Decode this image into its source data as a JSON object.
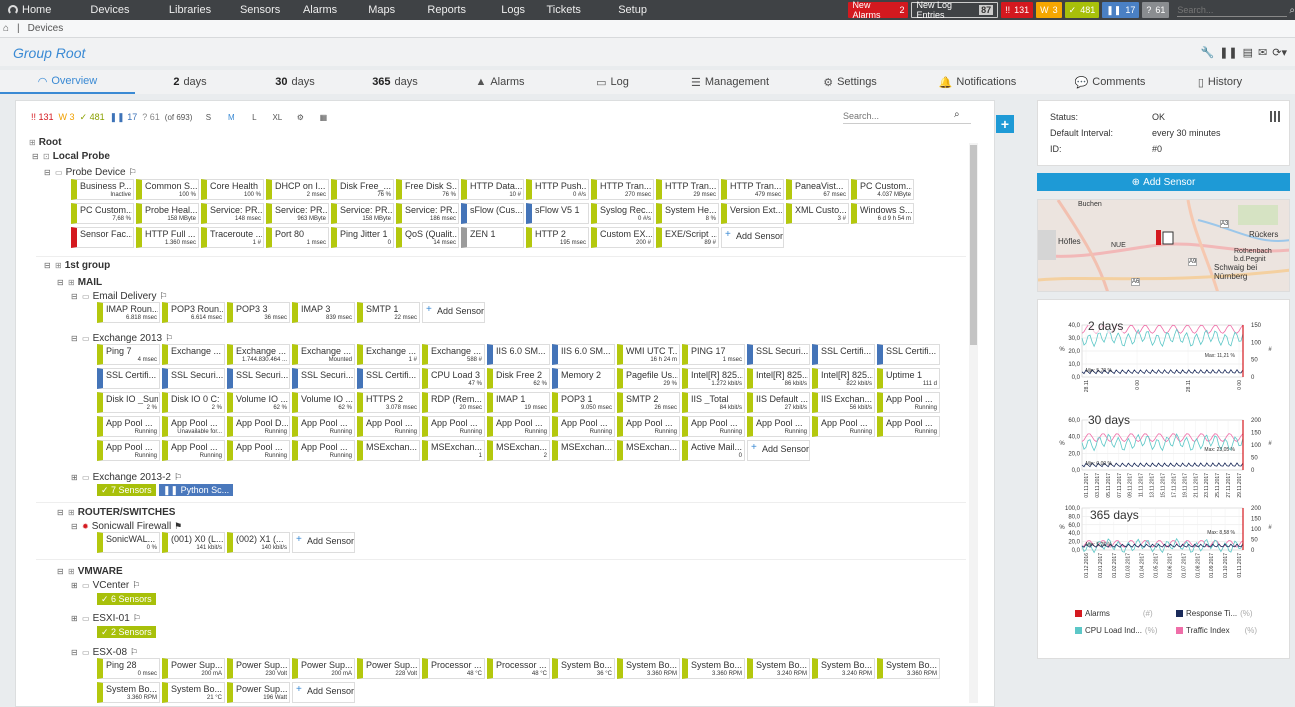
{
  "nav": {
    "home": "Home",
    "items": [
      "Devices",
      "Libraries",
      "Sensors",
      "Alarms",
      "Maps",
      "Reports",
      "Logs",
      "Tickets",
      "Setup"
    ],
    "new_alarms_label": "New Alarms",
    "new_alarms_count": "2",
    "new_log_label": "New Log Entries",
    "new_log_count": "87",
    "badge_red": "131",
    "badge_yellow": "3",
    "badge_green": "481",
    "badge_blue": "17",
    "badge_gray": "61",
    "search_placeholder": "Search..."
  },
  "breadcrumb": {
    "item": "Devices"
  },
  "page": {
    "title": "Group Root"
  },
  "tabs": [
    {
      "label": "Overview"
    },
    {
      "num": "2",
      "label": "days"
    },
    {
      "num": "30",
      "label": "days"
    },
    {
      "num": "365",
      "label": "days"
    },
    {
      "label": "Alarms"
    },
    {
      "label": "Log"
    },
    {
      "label": "Management"
    },
    {
      "label": "Settings"
    },
    {
      "label": "Notifications"
    },
    {
      "label": "Comments"
    },
    {
      "label": "History"
    }
  ],
  "filter": {
    "red": "131",
    "yellow": "3",
    "green": "481",
    "blue": "17",
    "gray": "61",
    "total": "(of 693)",
    "sizes": [
      "S",
      "M",
      "L",
      "XL"
    ],
    "search_placeholder": "Search..."
  },
  "tree": {
    "root": "Root",
    "local_probe": "Local Probe",
    "probe_device": "Probe Device",
    "group1": "1st group",
    "mail": "MAIL",
    "email_delivery": "Email Delivery",
    "exchange2013": "Exchange 2013",
    "exchange2013_2": "Exchange 2013-2",
    "seven_sensors": "7 Sensors",
    "python_chip": "Python Sc...",
    "router": "ROUTER/SWITCHES",
    "sonicwall": "Sonicwall Firewall",
    "vmware": "VMWARE",
    "vcenter": "VCenter",
    "six_sensors": "6 Sensors",
    "esxi01": "ESXI-01",
    "two_sensors": "2 Sensors",
    "esx08": "ESX-08",
    "add_sensor": "Add Sensor"
  },
  "probe_sensors": [
    {
      "n": "Business P...",
      "v": "Inactive",
      "c": "g"
    },
    {
      "n": "Common S...",
      "v": "100 %",
      "c": "g"
    },
    {
      "n": "Core Health",
      "v": "100 %",
      "c": "g"
    },
    {
      "n": "DHCP on I...",
      "v": "2 msec",
      "c": "g"
    },
    {
      "n": "Disk Free_...",
      "v": "76 %",
      "c": "g"
    },
    {
      "n": "Free Disk S...",
      "v": "76 %",
      "c": "g"
    },
    {
      "n": "HTTP Data...",
      "v": "10 #",
      "c": "g"
    },
    {
      "n": "HTTP Push...",
      "v": "0 #/s",
      "c": "g"
    },
    {
      "n": "HTTP Tran...",
      "v": "270 msec",
      "c": "g"
    },
    {
      "n": "HTTP Tran...",
      "v": "29 msec",
      "c": "g"
    },
    {
      "n": "HTTP Tran...",
      "v": "479 msec",
      "c": "g"
    },
    {
      "n": "PaneaVist...",
      "v": "67 msec",
      "c": "g"
    },
    {
      "n": "PC Custom...",
      "v": "4.037 MByte",
      "c": "g"
    },
    {
      "n": "PC Custom...",
      "v": "7,68 %",
      "c": "g"
    },
    {
      "n": "Probe Heal...",
      "v": "158 MByte",
      "c": "g"
    },
    {
      "n": "Service: PR...",
      "v": "148 msec",
      "c": "g"
    },
    {
      "n": "Service: PR...",
      "v": "963 MByte",
      "c": "g"
    },
    {
      "n": "Service: PR...",
      "v": "158 MByte",
      "c": "g"
    },
    {
      "n": "Service: PR...",
      "v": "186 msec",
      "c": "g"
    },
    {
      "n": "sFlow (Cus...",
      "v": "",
      "c": "b"
    },
    {
      "n": "sFlow V5 1",
      "v": "",
      "c": "b"
    },
    {
      "n": "Syslog Rec...",
      "v": "0 #/s",
      "c": "g"
    },
    {
      "n": "System He...",
      "v": "8 %",
      "c": "g"
    },
    {
      "n": "Version Ext...",
      "v": "",
      "c": "g"
    },
    {
      "n": "XML Custo...",
      "v": "3 #",
      "c": "g"
    },
    {
      "n": "Windows S...",
      "v": "6 d 9 h 54 m",
      "c": "g"
    },
    {
      "n": "Sensor Fac...",
      "v": "",
      "c": "r"
    },
    {
      "n": "HTTP Full ...",
      "v": "1.360 msec",
      "c": "g"
    },
    {
      "n": "Traceroute ...",
      "v": "1 #",
      "c": "g"
    },
    {
      "n": "Port 80",
      "v": "1 msec",
      "c": "g"
    },
    {
      "n": "Ping Jitter 1",
      "v": "0",
      "c": "g"
    },
    {
      "n": "QoS (Qualit...",
      "v": "14 msec",
      "c": "g"
    },
    {
      "n": "ZEN 1",
      "v": "",
      "c": "gr"
    },
    {
      "n": "HTTP 2",
      "v": "195 msec",
      "c": "g"
    },
    {
      "n": "Custom EX...",
      "v": "200 #",
      "c": "g"
    },
    {
      "n": "EXE/Script ...",
      "v": "89 #",
      "c": "g"
    },
    {
      "n": "Add Sensor",
      "v": "",
      "c": "add"
    }
  ],
  "email_sensors": [
    {
      "n": "IMAP Roun...",
      "v": "6.818 msec",
      "c": "g"
    },
    {
      "n": "POP3 Roun...",
      "v": "6.614 msec",
      "c": "g"
    },
    {
      "n": "POP3 3",
      "v": "36 msec",
      "c": "g"
    },
    {
      "n": "IMAP 3",
      "v": "839 msec",
      "c": "g"
    },
    {
      "n": "SMTP 1",
      "v": "22 msec",
      "c": "g"
    },
    {
      "n": "Add Sensor",
      "v": "",
      "c": "add"
    }
  ],
  "exchange_sensors": [
    {
      "n": "Ping 7",
      "v": "4 msec",
      "c": "g"
    },
    {
      "n": "Exchange ...",
      "v": "",
      "c": "g"
    },
    {
      "n": "Exchange ...",
      "v": "1.744.830.464 ...",
      "c": "g"
    },
    {
      "n": "Exchange ...",
      "v": "Mounted",
      "c": "g"
    },
    {
      "n": "Exchange ...",
      "v": "1 #",
      "c": "g"
    },
    {
      "n": "Exchange ...",
      "v": "588 #",
      "c": "g"
    },
    {
      "n": "IIS 6.0 SM...",
      "v": "",
      "c": "b"
    },
    {
      "n": "IIS 6.0 SM...",
      "v": "",
      "c": "b"
    },
    {
      "n": "WMI UTC T...",
      "v": "16 h 24 m",
      "c": "g"
    },
    {
      "n": "PING 17",
      "v": "1 msec",
      "c": "g"
    },
    {
      "n": "SSL Securi...",
      "v": "",
      "c": "b"
    },
    {
      "n": "SSL Certifi...",
      "v": "",
      "c": "b"
    },
    {
      "n": "SSL Certifi...",
      "v": "",
      "c": "b"
    },
    {
      "n": "SSL Certifi...",
      "v": "",
      "c": "b"
    },
    {
      "n": "SSL Securi...",
      "v": "",
      "c": "b"
    },
    {
      "n": "SSL Securi...",
      "v": "",
      "c": "b"
    },
    {
      "n": "SSL Securi...",
      "v": "",
      "c": "b"
    },
    {
      "n": "SSL Certifi...",
      "v": "",
      "c": "b"
    },
    {
      "n": "CPU Load 3",
      "v": "47 %",
      "c": "g"
    },
    {
      "n": "Disk Free 2",
      "v": "62 %",
      "c": "g"
    },
    {
      "n": "Memory 2",
      "v": "",
      "c": "b"
    },
    {
      "n": "Pagefile Us...",
      "v": "29 %",
      "c": "g"
    },
    {
      "n": "Intel[R] 825...",
      "v": "1.272 kbit/s",
      "c": "g"
    },
    {
      "n": "Intel[R] 825...",
      "v": "86 kbit/s",
      "c": "g"
    },
    {
      "n": "Intel[R] 825...",
      "v": "822 kbit/s",
      "c": "g"
    },
    {
      "n": "Uptime 1",
      "v": "111 d",
      "c": "g"
    },
    {
      "n": "Disk IO _Sum",
      "v": "2 %",
      "c": "g"
    },
    {
      "n": "Disk IO 0 C:",
      "v": "2 %",
      "c": "g"
    },
    {
      "n": "Volume IO ...",
      "v": "62 %",
      "c": "g"
    },
    {
      "n": "Volume IO ...",
      "v": "62 %",
      "c": "g"
    },
    {
      "n": "HTTPS 2",
      "v": "3.078 msec",
      "c": "g"
    },
    {
      "n": "RDP (Rem...",
      "v": "20 msec",
      "c": "g"
    },
    {
      "n": "IMAP 1",
      "v": "19 msec",
      "c": "g"
    },
    {
      "n": "POP3 1",
      "v": "9.050 msec",
      "c": "g"
    },
    {
      "n": "SMTP 2",
      "v": "26 msec",
      "c": "g"
    },
    {
      "n": "IIS _Total",
      "v": "84 kbit/s",
      "c": "g"
    },
    {
      "n": "IIS Default ...",
      "v": "27 kbit/s",
      "c": "g"
    },
    {
      "n": "IIS Exchan...",
      "v": "56 kbit/s",
      "c": "g"
    },
    {
      "n": "App Pool ...",
      "v": "Running",
      "c": "g"
    },
    {
      "n": "App Pool ...",
      "v": "Running",
      "c": "g"
    },
    {
      "n": "App Pool ...",
      "v": "Unavailable for...",
      "c": "g"
    },
    {
      "n": "App Pool D...",
      "v": "Running",
      "c": "g"
    },
    {
      "n": "App Pool ...",
      "v": "Running",
      "c": "g"
    },
    {
      "n": "App Pool ...",
      "v": "Running",
      "c": "g"
    },
    {
      "n": "App Pool ...",
      "v": "Running",
      "c": "g"
    },
    {
      "n": "App Pool ...",
      "v": "Running",
      "c": "g"
    },
    {
      "n": "App Pool ...",
      "v": "Running",
      "c": "g"
    },
    {
      "n": "App Pool ...",
      "v": "Running",
      "c": "g"
    },
    {
      "n": "App Pool ...",
      "v": "Running",
      "c": "g"
    },
    {
      "n": "App Pool ...",
      "v": "Running",
      "c": "g"
    },
    {
      "n": "App Pool ...",
      "v": "Running",
      "c": "g"
    },
    {
      "n": "App Pool ...",
      "v": "Running",
      "c": "g"
    },
    {
      "n": "App Pool ...",
      "v": "Running",
      "c": "g"
    },
    {
      "n": "App Pool ...",
      "v": "Running",
      "c": "g"
    },
    {
      "n": "App Pool ...",
      "v": "Running",
      "c": "g"
    },
    {
      "n": "App Pool ...",
      "v": "Running",
      "c": "g"
    },
    {
      "n": "MSExchan...",
      "v": "",
      "c": "g"
    },
    {
      "n": "MSExchan...",
      "v": "1",
      "c": "g"
    },
    {
      "n": "MSExchan...",
      "v": "2",
      "c": "g"
    },
    {
      "n": "MSExchan...",
      "v": "",
      "c": "g"
    },
    {
      "n": "MSExchan...",
      "v": "",
      "c": "g"
    },
    {
      "n": "Active Mail...",
      "v": "0",
      "c": "g"
    },
    {
      "n": "Add Sensor",
      "v": "",
      "c": "add"
    }
  ],
  "sonicwall_sensors": [
    {
      "n": "SonicWAL...",
      "v": "0 %",
      "c": "g"
    },
    {
      "n": "(001) X0 (L...",
      "v": "141 kbit/s",
      "c": "g"
    },
    {
      "n": "(002) X1 (...",
      "v": "140 kbit/s",
      "c": "g"
    },
    {
      "n": "Add Sensor",
      "v": "",
      "c": "add"
    }
  ],
  "esx08_sensors": [
    {
      "n": "Ping 28",
      "v": "0 msec",
      "c": "g"
    },
    {
      "n": "Power Sup...",
      "v": "200 mA",
      "c": "g"
    },
    {
      "n": "Power Sup...",
      "v": "230 Volt",
      "c": "g"
    },
    {
      "n": "Power Sup...",
      "v": "200 mA",
      "c": "g"
    },
    {
      "n": "Power Sup...",
      "v": "228 Volt",
      "c": "g"
    },
    {
      "n": "Processor ...",
      "v": "48 °C",
      "c": "g"
    },
    {
      "n": "Processor ...",
      "v": "48 °C",
      "c": "g"
    },
    {
      "n": "System Bo...",
      "v": "36 °C",
      "c": "g"
    },
    {
      "n": "System Bo...",
      "v": "3.360 RPM",
      "c": "g"
    },
    {
      "n": "System Bo...",
      "v": "3.360 RPM",
      "c": "g"
    },
    {
      "n": "System Bo...",
      "v": "3.240 RPM",
      "c": "g"
    },
    {
      "n": "System Bo...",
      "v": "3.240 RPM",
      "c": "g"
    },
    {
      "n": "System Bo...",
      "v": "3.360 RPM",
      "c": "g"
    },
    {
      "n": "System Bo...",
      "v": "3.360 RPM",
      "c": "g"
    },
    {
      "n": "System Bo...",
      "v": "21 °C",
      "c": "g"
    },
    {
      "n": "Power Sup...",
      "v": "196 Watt",
      "c": "g"
    },
    {
      "n": "Add Sensor",
      "v": "",
      "c": "add"
    }
  ],
  "side": {
    "status_label": "Status:",
    "status_value": "OK",
    "interval_label": "Default Interval:",
    "interval_value": "every  30 minutes",
    "id_label": "ID:",
    "id_value": "#0",
    "add_sensor": "Add Sensor",
    "map_labels": [
      "Höfles",
      "NUE",
      "Rückers",
      "Rothenbach b.d.Pegnit",
      "Schwaig bei Nürnberg",
      "Buchen",
      "A3",
      "A9",
      "A6"
    ]
  },
  "graphs": {
    "g1": {
      "label": "2 days",
      "y_left": [
        "40,0",
        "30,0",
        "20,0",
        "10,0",
        "0,0"
      ],
      "y_right": [
        "150",
        "100",
        "50",
        "0"
      ],
      "x": [
        "28.11",
        "0 00",
        "28.11",
        "0 00"
      ],
      "max": "Max: 11,21 %",
      "min": "Min: 5,70 %"
    },
    "g2": {
      "label": "30 days",
      "y_left": [
        "60,0",
        "40,0",
        "20,0",
        "0,0"
      ],
      "y_right": [
        "200",
        "150",
        "100",
        "50",
        "0"
      ],
      "x": [
        "01.11.2017",
        "03.11.2017",
        "05.11.2017",
        "07.11.2017",
        "09.11.2017",
        "11.11.2017",
        "13.11.2017",
        "15.11.2017",
        "17.11.2017",
        "19.11.2017",
        "21.11.2017",
        "23.11.2017",
        "25.11.2017",
        "27.11.2017",
        "29.11.2017"
      ],
      "max": "Max: 23,05 %",
      "min": "Min: 0,00 %"
    },
    "g3": {
      "label": "365 days",
      "y_left": [
        "100,0",
        "80,0",
        "60,0",
        "40,0",
        "20,0",
        "0,0"
      ],
      "y_right": [
        "200",
        "150",
        "100",
        "50",
        "0"
      ],
      "x": [
        "01.12.2016",
        "01.01.2017",
        "01.02.2017",
        "01.03.2017",
        "01.04.2017",
        "01.05.2017",
        "01.06.2017",
        "01.07.2017",
        "01.08.2017",
        "01.09.2017",
        "01.10.2017",
        "01.11.2017"
      ],
      "max": "Max: 8,58 %",
      "min": "Min: 5,25 %"
    },
    "y_left_unit": "%",
    "y_right_unit": "#",
    "legend": [
      {
        "label": "Alarms",
        "pct": "(#)",
        "color": "#d4191f"
      },
      {
        "label": "Response Ti...",
        "pct": "(%)",
        "color": "#1a2a5a"
      },
      {
        "label": "CPU Load Ind...",
        "pct": "(%)",
        "color": "#5cc7c7"
      },
      {
        "label": "Traffic Index",
        "pct": "(%)",
        "color": "#ef6ea8"
      }
    ]
  }
}
